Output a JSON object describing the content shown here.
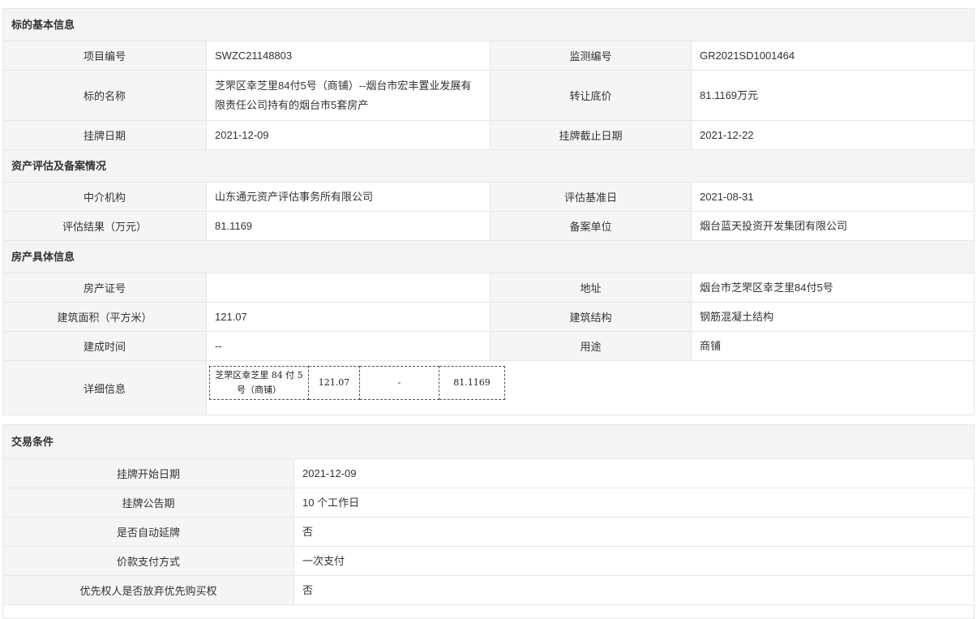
{
  "basic": {
    "title": "标的基本信息",
    "project_no_label": "项目编号",
    "project_no": "SWZC21148803",
    "monitor_no_label": "监测编号",
    "monitor_no": "GR2021SD1001464",
    "name_label": "标的名称",
    "name": "芝罘区幸芝里84付5号（商铺）--烟台市宏丰置业发展有限责任公司持有的烟台市5套房产",
    "price_label": "转让底价",
    "price": "81.1169万元",
    "list_date_label": "挂牌日期",
    "list_date": "2021-12-09",
    "deadline_label": "挂牌截止日期",
    "deadline": "2021-12-22"
  },
  "assessment": {
    "title": "资产评估及备案情况",
    "agency_label": "中介机构",
    "agency": "山东通元资产评估事务所有限公司",
    "base_date_label": "评估基准日",
    "base_date": "2021-08-31",
    "result_label": "评估结果（万元）",
    "result": "81.1169",
    "record_unit_label": "备案单位",
    "record_unit": "烟台蓝天投资开发集团有限公司"
  },
  "property": {
    "title": "房产具体信息",
    "cert_label": "房产证号",
    "cert": "",
    "address_label": "地址",
    "address": "烟台市芝罘区幸芝里84付5号",
    "area_label": "建筑面积（平方米）",
    "area": "121.07",
    "structure_label": "建筑结构",
    "structure": "钢筋混凝土结构",
    "built_label": "建成时间",
    "built": "--",
    "usage_label": "用途",
    "usage": "商铺",
    "detail_label": "详细信息",
    "detail_table": {
      "name": "芝罘区幸芝里 84 付 5 号（商铺）",
      "area": "121.07",
      "dash": "-",
      "value": "81.1169"
    }
  },
  "trade": {
    "title": "交易条件",
    "rows": [
      {
        "label": "挂牌开始日期",
        "value": "2021-12-09"
      },
      {
        "label": "挂牌公告期",
        "value": "10 个工作日"
      },
      {
        "label": "是否自动延牌",
        "value": "否"
      },
      {
        "label": "价款支付方式",
        "value": "一次支付"
      },
      {
        "label": "优先权人是否放弃优先购买权",
        "value": "否"
      }
    ]
  }
}
